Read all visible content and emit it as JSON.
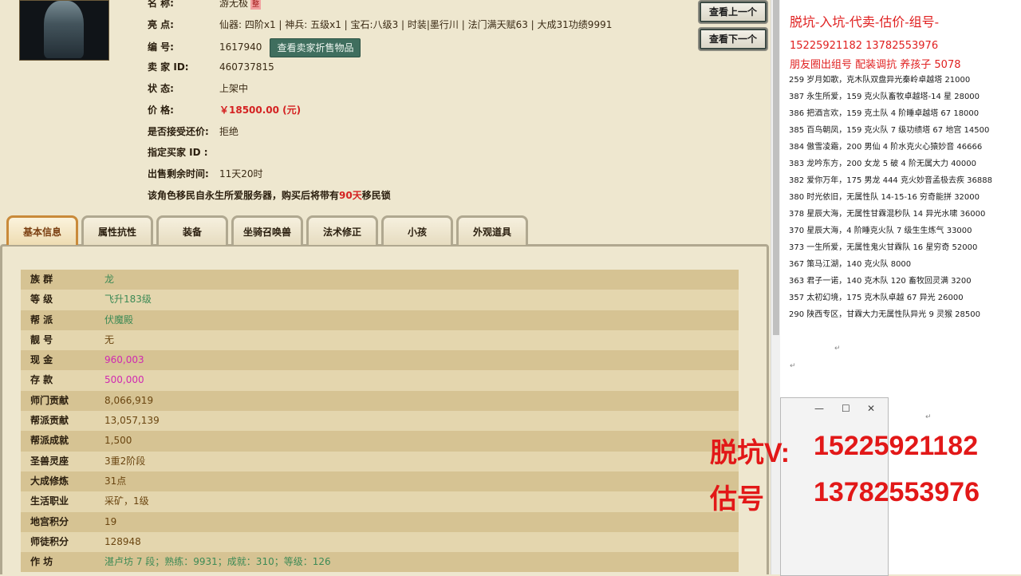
{
  "detail": {
    "name_key": "名 称:",
    "name_val": "游无极",
    "name_badge": "整",
    "highlight_key": "亮 点:",
    "highlight_val": "仙器: 四阶x1 | 神兵: 五级x1 | 宝石:八级3 | 时装|墨行川 | 法门满天赋63 | 大成31功绩9991",
    "id_key": "编 号:",
    "id_val": "1617940",
    "seller_items_btn": "查看卖家折售物品",
    "seller_key": "卖 家 ID:",
    "seller_val": "460737815",
    "status_key": "状 态:",
    "status_val": "上架中",
    "price_key": "价 格:",
    "price_val": "￥18500.00 (元)",
    "bargain_key": "是否接受还价:",
    "bargain_val": "拒绝",
    "buyer_key": "指定买家 ID :",
    "remain_key": "出售剩余时间:",
    "remain_val": "11天20时",
    "migration_pre": "该角色移民自永生所爱服务器，购买后将带有",
    "migration_days": "90天",
    "migration_post": "移民锁"
  },
  "nav": {
    "prev": "查看上一个",
    "next": "查看下一个"
  },
  "tabs": [
    "基本信息",
    "属性抗性",
    "装备",
    "坐骑召唤兽",
    "法术修正",
    "小孩",
    "外观道具"
  ],
  "basic_info": [
    {
      "k": "族 群",
      "v": "龙",
      "c": "green"
    },
    {
      "k": "等 级",
      "v": "飞升183级",
      "c": "green"
    },
    {
      "k": "帮 派",
      "v": "伏魔殿",
      "c": "green"
    },
    {
      "k": "靓 号",
      "v": "无",
      "c": "brown"
    },
    {
      "k": "现 金",
      "v": "960,003",
      "c": "pink"
    },
    {
      "k": "存 款",
      "v": "500,000",
      "c": "pink"
    },
    {
      "k": "师门贡献",
      "v": "8,066,919",
      "c": "brown"
    },
    {
      "k": "帮派贡献",
      "v": "13,057,139",
      "c": "brown"
    },
    {
      "k": "帮派成就",
      "v": "1,500",
      "c": "brown"
    },
    {
      "k": "圣兽灵座",
      "v": "3重2阶段",
      "c": "brown"
    },
    {
      "k": "大成修炼",
      "v": "31点",
      "c": "brown"
    },
    {
      "k": "生活职业",
      "v": "采矿，1级",
      "c": "brown"
    },
    {
      "k": "地宫积分",
      "v": "19",
      "c": "brown"
    },
    {
      "k": "师徒积分",
      "v": "128948",
      "c": "brown"
    },
    {
      "k": "作 坊",
      "v": "湛卢坊 7 段；熟练：9931；成就：310；等级：126",
      "c": "green"
    }
  ],
  "notes": {
    "title": "脱坑-入坑-代卖-估价-组号-",
    "phones": "15225921182    13782553976",
    "line3": "朋友圈出组号   配装调抗  养孩子 5078",
    "items": [
      "259 岁月如歌，克木队双盘异光秦岭卓越塔 21000",
      "387 永生所爱，159 克火队畜牧卓越塔-14 星 28000",
      "386 把酒言欢，159 克土队 4 阶睡卓越塔 67 18000",
      "385 百鸟朝凤，159 克火队 7 级功绩塔 67 地宫 14500",
      "384 傲雪凌霜，200 男仙 4 阶水克火心猿妙音 46666",
      "383 龙吟东方，200 女龙 5 破 4 阶无属大力 40000",
      "382 爱你万年，175 男龙 444 克火妙音孟极去疾 36888",
      "380 时光依旧，无属性队 14-15-16 穷奇能拼 32000",
      "378 星辰大海，无属性甘霖混秒队 14 异光水啸 36000",
      "370 星辰大海，4 阶睡克火队 7 级生生炼气 33000",
      "373 一生所爱，无属性鬼火甘霖队 16 星穷奇 52000",
      "367 策马江湖，140 克火队 8000",
      "363 君子一诺，140 克木队 120 畜牧回灵满 3200",
      "357 太初幻境，175 克木队卓越 67 异光 26000",
      "290 陕西专区，甘霖大力无属性队异光 9 灵猴 28500"
    ]
  },
  "overlay": {
    "l1_label": "脱坑V:",
    "l1_num": "15225921182",
    "l2_label": "估号",
    "l2_num": "13782553976"
  }
}
